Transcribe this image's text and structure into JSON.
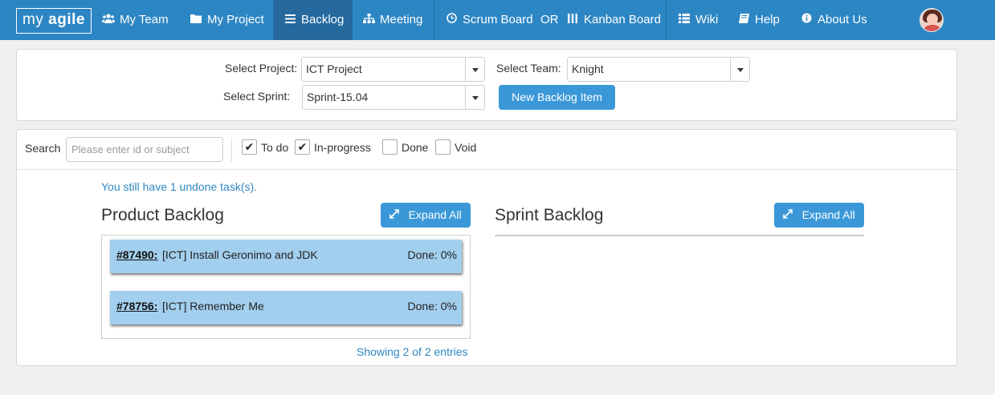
{
  "brand": {
    "text_prefix": "my ",
    "text_bold": "agile"
  },
  "nav": {
    "my_team": "My Team",
    "my_project": "My Project",
    "backlog": "Backlog",
    "meeting": "Meeting",
    "scrum_board": "Scrum Board",
    "or": "OR",
    "kanban_board": "Kanban Board",
    "wiki": "Wiki",
    "help": "Help",
    "about_us": "About Us"
  },
  "selectors": {
    "project_label": "Select Project:",
    "project_value": "ICT Project",
    "team_label": "Select Team:",
    "team_value": "Knight",
    "sprint_label": "Select Sprint:",
    "sprint_value": "Sprint-15.04",
    "new_backlog_button": "New Backlog Item"
  },
  "filters": {
    "search_label": "Search",
    "search_placeholder": "Please enter id or subject",
    "search_value": "",
    "statuses": [
      {
        "label": "To do",
        "checked": true
      },
      {
        "label": "In-progress",
        "checked": true
      },
      {
        "label": "Done",
        "checked": false
      },
      {
        "label": "Void",
        "checked": false
      }
    ]
  },
  "notice": "You still have 1 undone task(s).",
  "product_backlog": {
    "title": "Product Backlog",
    "expand_label": "Expand All",
    "items": [
      {
        "id": "#87490:",
        "subject": "[ICT] Install Geronimo and JDK",
        "done": "Done: 0%"
      },
      {
        "id": "#78756:",
        "subject": "[ICT] Remember Me",
        "done": "Done: 0%"
      }
    ],
    "entries_text": "Showing 2 of 2 entries"
  },
  "sprint_backlog": {
    "title": "Sprint Backlog",
    "expand_label": "Expand All"
  },
  "colors": {
    "navbar": "#2d86c4",
    "navbar_active": "#25699e",
    "button": "#3a98d8",
    "item_bg": "#a3cfee",
    "link": "#2f87c1"
  }
}
